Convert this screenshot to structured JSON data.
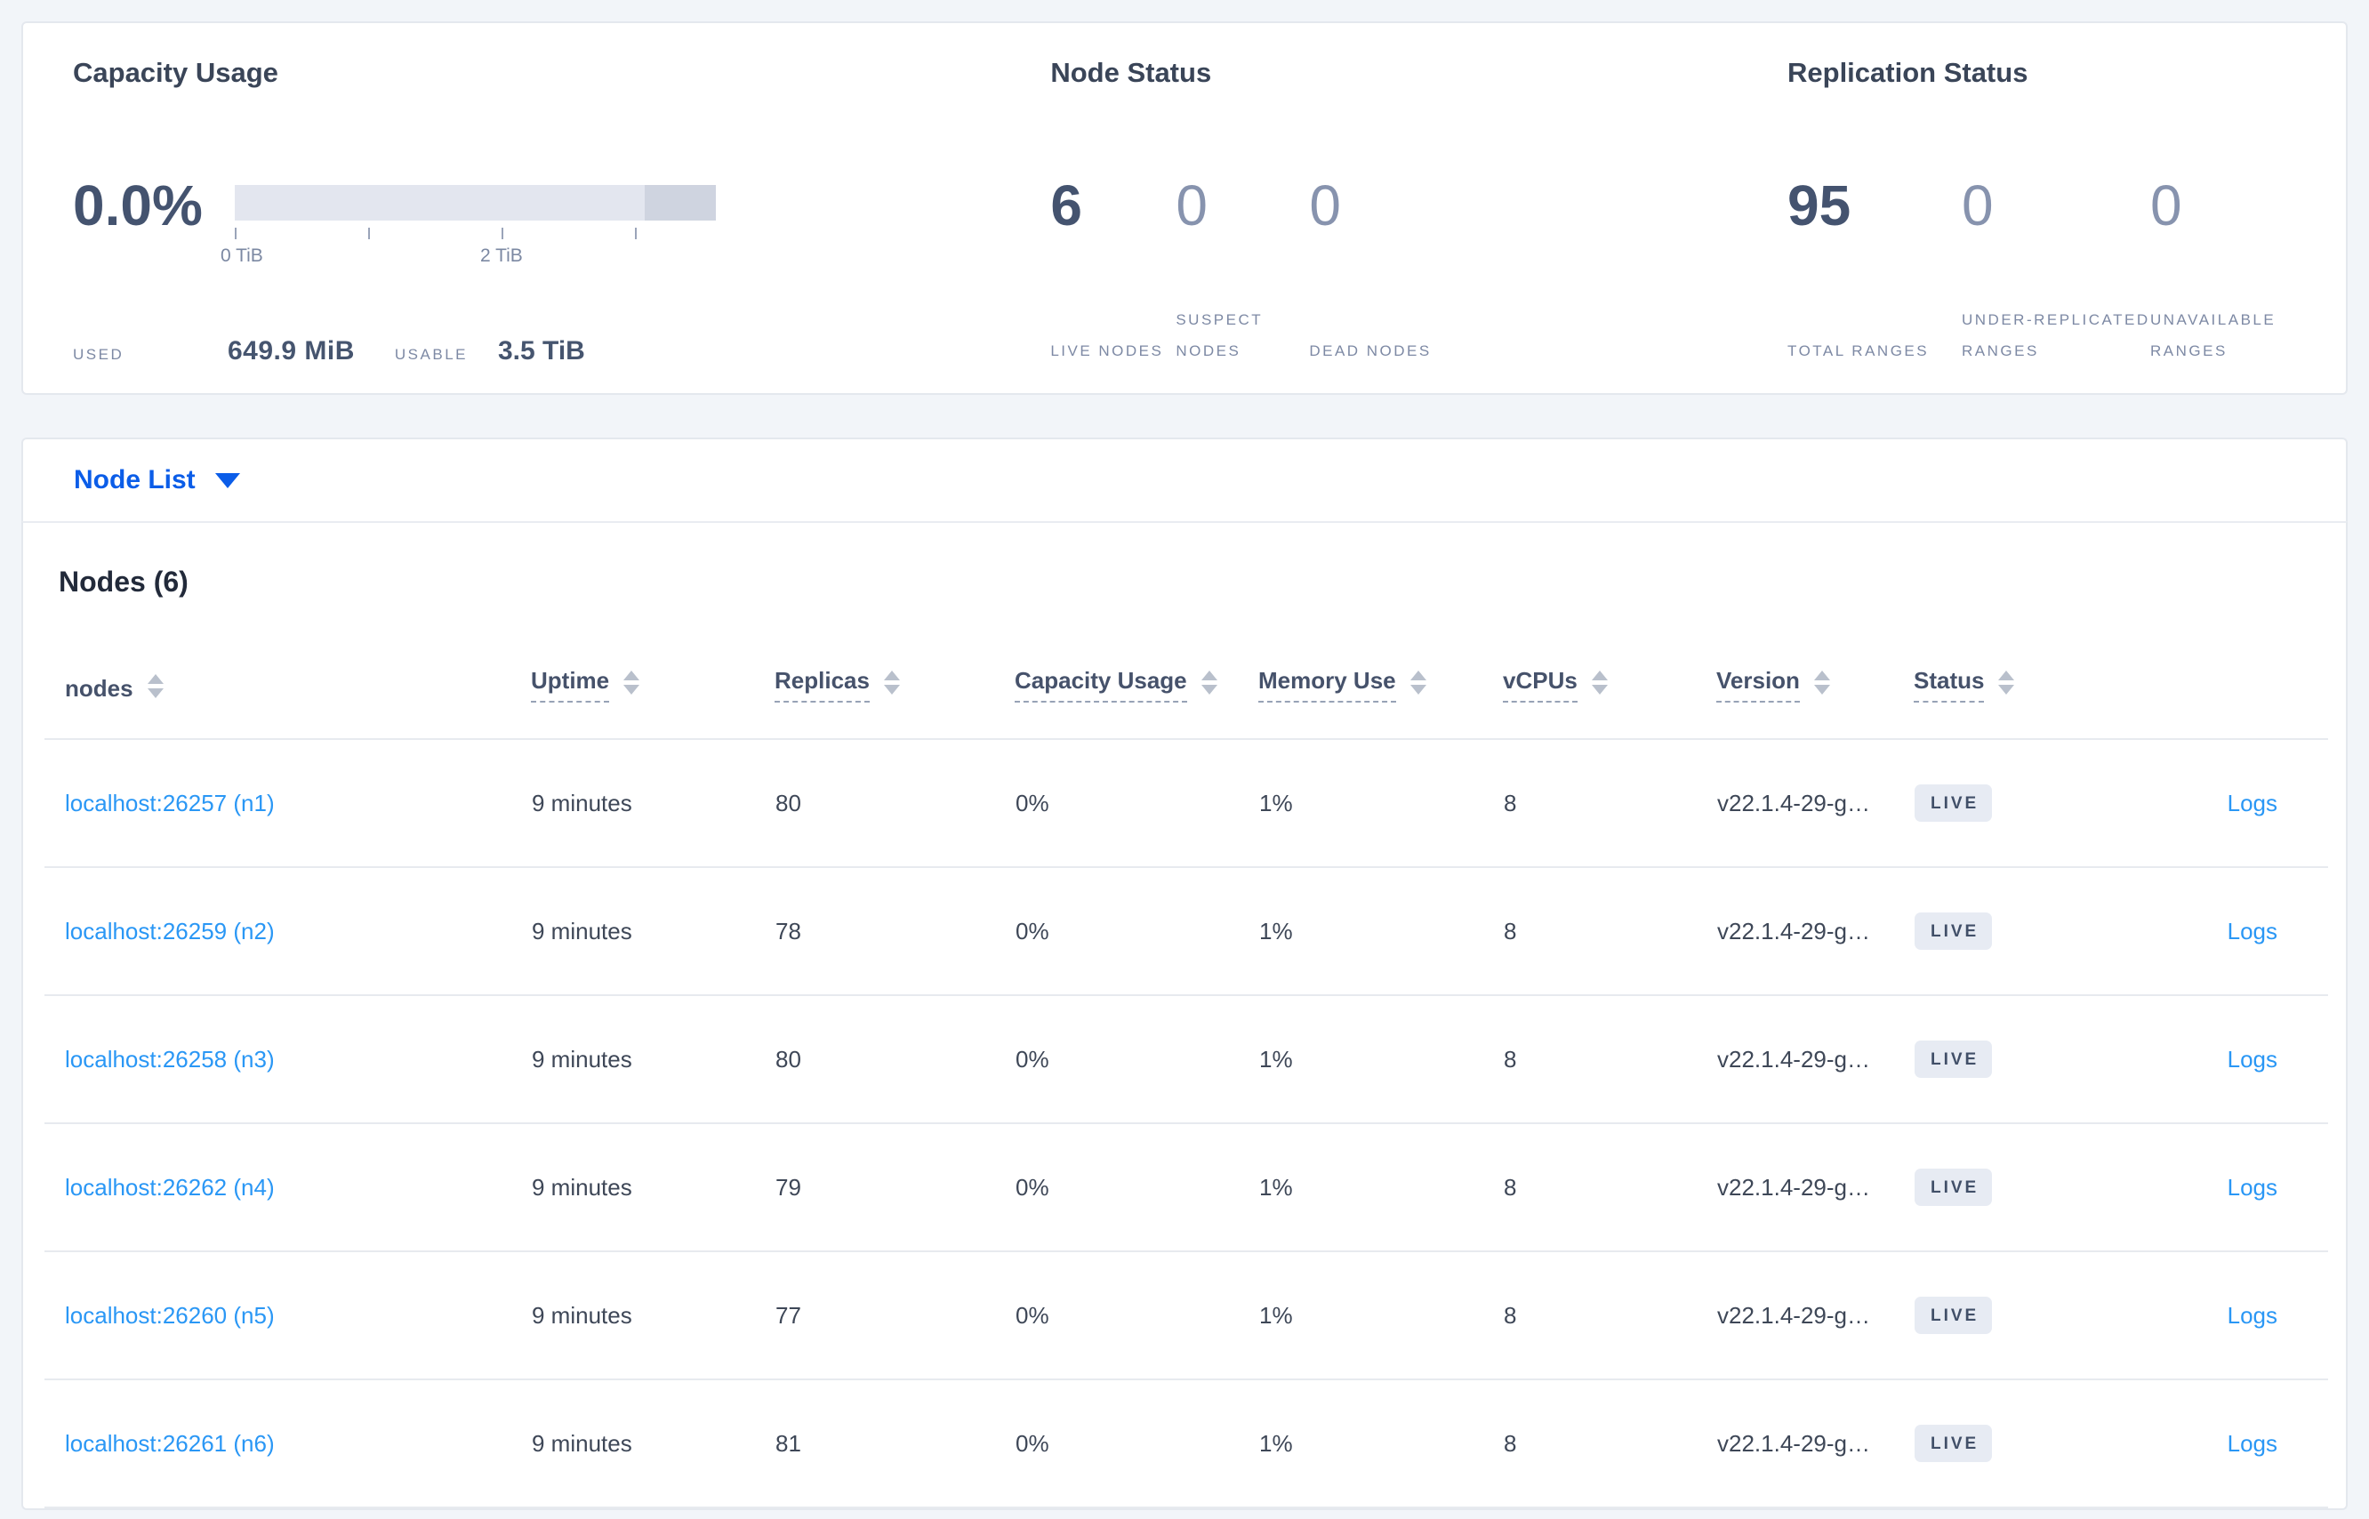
{
  "summary": {
    "capacity": {
      "title": "Capacity Usage",
      "percent": "0.0%",
      "tick_label_0": "0 TiB",
      "tick_label_2": "2 TiB",
      "used_label": "USED",
      "used_value": "649.9 MiB",
      "usable_label": "USABLE",
      "usable_value": "3.5 TiB"
    },
    "node_status": {
      "title": "Node Status",
      "stats": [
        {
          "value": "6",
          "label": "LIVE NODES",
          "muted": false
        },
        {
          "value": "0",
          "label": "SUSPECT NODES",
          "muted": true
        },
        {
          "value": "0",
          "label": "DEAD NODES",
          "muted": true
        }
      ]
    },
    "replication": {
      "title": "Replication Status",
      "stats": [
        {
          "value": "95",
          "label": "TOTAL RANGES",
          "muted": false
        },
        {
          "value": "0",
          "label": "UNDER-REPLICATED RANGES",
          "muted": true
        },
        {
          "value": "0",
          "label": "UNAVAILABLE RANGES",
          "muted": true
        }
      ]
    }
  },
  "nav": {
    "selector_label": "Node List"
  },
  "nodes_table": {
    "title": "Nodes (6)",
    "columns": [
      {
        "label": "nodes",
        "underline": false,
        "sortable": true
      },
      {
        "label": "Uptime",
        "underline": true,
        "sortable": true
      },
      {
        "label": "Replicas",
        "underline": true,
        "sortable": true
      },
      {
        "label": "Capacity Usage",
        "underline": true,
        "sortable": true
      },
      {
        "label": "Memory Use",
        "underline": true,
        "sortable": true
      },
      {
        "label": "vCPUs",
        "underline": true,
        "sortable": true
      },
      {
        "label": "Version",
        "underline": true,
        "sortable": true
      },
      {
        "label": "Status",
        "underline": true,
        "sortable": true
      },
      {
        "label": "",
        "underline": false,
        "sortable": false
      }
    ],
    "rows": [
      {
        "node": "localhost:26257 (n1)",
        "uptime": "9 minutes",
        "replicas": "80",
        "capacity": "0%",
        "memory": "1%",
        "vcpus": "8",
        "version": "v22.1.4-29-g…",
        "status": "LIVE",
        "logs": "Logs"
      },
      {
        "node": "localhost:26259 (n2)",
        "uptime": "9 minutes",
        "replicas": "78",
        "capacity": "0%",
        "memory": "1%",
        "vcpus": "8",
        "version": "v22.1.4-29-g…",
        "status": "LIVE",
        "logs": "Logs"
      },
      {
        "node": "localhost:26258 (n3)",
        "uptime": "9 minutes",
        "replicas": "80",
        "capacity": "0%",
        "memory": "1%",
        "vcpus": "8",
        "version": "v22.1.4-29-g…",
        "status": "LIVE",
        "logs": "Logs"
      },
      {
        "node": "localhost:26262 (n4)",
        "uptime": "9 minutes",
        "replicas": "79",
        "capacity": "0%",
        "memory": "1%",
        "vcpus": "8",
        "version": "v22.1.4-29-g…",
        "status": "LIVE",
        "logs": "Logs"
      },
      {
        "node": "localhost:26260 (n5)",
        "uptime": "9 minutes",
        "replicas": "77",
        "capacity": "0%",
        "memory": "1%",
        "vcpus": "8",
        "version": "v22.1.4-29-g…",
        "status": "LIVE",
        "logs": "Logs"
      },
      {
        "node": "localhost:26261 (n6)",
        "uptime": "9 minutes",
        "replicas": "81",
        "capacity": "0%",
        "memory": "1%",
        "vcpus": "8",
        "version": "v22.1.4-29-g…",
        "status": "LIVE",
        "logs": "Logs"
      }
    ]
  },
  "colors": {
    "accent_blue": "#0b5de8",
    "link_blue": "#2a97f5",
    "badge_bg": "#e7ebf3",
    "stat_dark": "#44536f",
    "stat_muted": "#8793ae",
    "page_bg": "#f2f5f9"
  }
}
